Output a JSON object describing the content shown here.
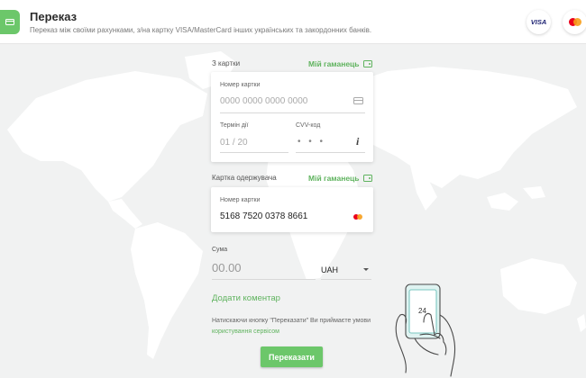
{
  "header": {
    "title": "Переказ",
    "subtitle": "Переказ між своїми рахунками, з/на картку VISA/MasterCard інших українських та закордонних банків.",
    "logos": [
      "visa-logo",
      "mastercard-logo"
    ],
    "visa_text": "VISA"
  },
  "from_card": {
    "section_label": "З картки",
    "wallet_link": "Мій гаманець",
    "card_number_label": "Номер картки",
    "card_number_placeholder": "0000 0000 0000 0000",
    "expiry_label": "Термін дії",
    "expiry_placeholder": "01 / 20",
    "cvv_label": "CVV-код",
    "cvv_value": "• • •"
  },
  "to_card": {
    "section_label": "Картка одержувача",
    "wallet_link": "Мій гаманець",
    "card_number_label": "Номер картки",
    "card_number_value": "5168 7520 0378 8661"
  },
  "amount": {
    "label": "Сума",
    "placeholder": "00.00",
    "currency": "UAH"
  },
  "comment_link": "Додати коментар",
  "terms": {
    "text": "Натискаючи кнопку \"Переказати\" Ви приймаєте умови",
    "link": "користування сервісом"
  },
  "submit_label": "Переказати",
  "illustration": {
    "phone_screen_text": "24"
  },
  "colors": {
    "accent": "#6cc76a",
    "link": "#5fb35e",
    "background": "#f1f2f2"
  }
}
